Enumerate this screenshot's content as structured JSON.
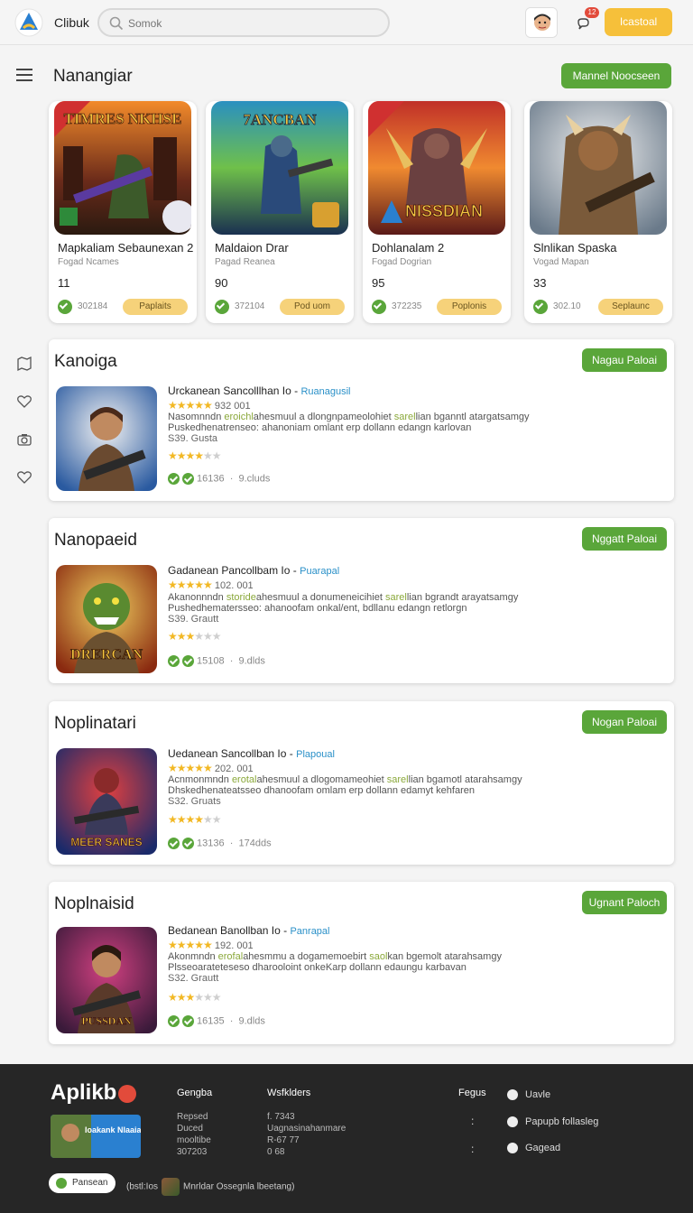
{
  "header": {
    "brand": "Clibuk",
    "search_placeholder": "Somok",
    "notif_count": "12",
    "login_label": "Icastoal"
  },
  "main": {
    "title": "Nanangiar",
    "title_button": "Mannel Noocseen"
  },
  "featured": [
    {
      "title": "Mapkaliam Sebaunexan 2",
      "sub": "Fogad Ncames",
      "score": "11",
      "meta": "302184",
      "pill": "Paplaits",
      "art_title": "TIMRES NKHSE"
    },
    {
      "title": "Maldaion Drar",
      "sub": "Pagad Reanea",
      "score": "90",
      "meta": "372104",
      "pill": "Pod uom",
      "art_title": "7ANCBAN"
    },
    {
      "title": "Dohlanalam 2",
      "sub": "Fogad Dogrian",
      "score": "95",
      "meta": "372235",
      "pill": "Poplonis",
      "art_title": "NISSDIAN"
    },
    {
      "title": "Slnlikan Spaska",
      "sub": "Vogad Mapan",
      "score": "33",
      "meta": "302.10",
      "pill": "Seplaunc",
      "art_title": ""
    }
  ],
  "sections": [
    {
      "title": "Kanoiga",
      "button": "Nagau Paloai",
      "app_name": "Urckanean Sancolllhan Io -",
      "app_tag": "Ruanagusil",
      "rating_text": "932 001",
      "desc_a": "Nasomnndn ",
      "desc_hl1": "eroichl",
      "desc_b": "ahesmuul a dlongnpameolohiet ",
      "desc_hl2": "sarel",
      "desc_c": "lian bganntl atargatsamgy",
      "desc_line2": "Puskedhenatrenseo: ahanoniam omlant erp dollann edangn karlovan",
      "price": "S39. Gusta",
      "stars_on": 4,
      "stats": "16136",
      "extra": "9.cluds",
      "art_title": ""
    },
    {
      "title": "Nanopaeid",
      "button": "Nggatt Paloai",
      "app_name": "Gadanean Pancollbam Io -",
      "app_tag": "Puarapal",
      "rating_text": "102. 001",
      "desc_a": "Akanonnndn ",
      "desc_hl1": "storide",
      "desc_b": "ahesmuul a donumeneicihiet ",
      "desc_hl2": "sarel",
      "desc_c": "lian bgrandt arayatsamgy",
      "desc_line2": "Pushedhematersseo: ahanoofam onkal/ent, bdllanu edangn retlorgn",
      "price": "S39. Grautt",
      "stars_on": 3,
      "stats": "15108",
      "extra": "9.dlds",
      "art_title": "DRERCAN"
    },
    {
      "title": "Noplinatari",
      "button": "Nogan Paloai",
      "app_name": "Uedanean Sancollban Io -",
      "app_tag": "Plapoual",
      "rating_text": "202. 001",
      "desc_a": "Acnmonmndn ",
      "desc_hl1": "erotal",
      "desc_b": "ahesmuul a dlogomameohiet ",
      "desc_hl2": "sarel",
      "desc_c": "lian bgamotl atarahsamgy",
      "desc_line2": "Dhskedhenateatsseo dhanoofam omlam erp dollann edamyt kehfaren",
      "price": "S32. Gruats",
      "stars_on": 4,
      "stats": "13136",
      "extra": "174dds",
      "art_title": "MEER SANES"
    },
    {
      "title": "Noplnaisid",
      "button": "Ugnant Paloch",
      "app_name": "Bedanean Banollban Io -",
      "app_tag": "Panrapal",
      "rating_text": "192. 001",
      "desc_a": "Akonmndn ",
      "desc_hl1": "erofal",
      "desc_b": "ahesmmu a dogamemoebirt ",
      "desc_hl2": "saol",
      "desc_c": "kan bgemolt atarahsamgy",
      "desc_line2": "Plsseoarateteseso dharooloint onkeKarp dollann edaungu karbavan",
      "price": "S32. Grautt",
      "stars_on": 3,
      "stats": "16135",
      "extra": "9.dlds",
      "art_title": "PUSSDAN"
    }
  ],
  "footer": {
    "brand": "Aplikb",
    "thumb_title": "Ioakank Nlaaiao",
    "col1_title": "Gengba",
    "col1_lines": [
      "Repsed",
      "Duced",
      "mooltibe",
      "307203"
    ],
    "col2_title": "Wsfklders",
    "col2_lines": [
      "f. 7343",
      "Uagnasinahanmare",
      "R-67 77",
      "0 68"
    ],
    "col3_title": "Fegus",
    "links": [
      "Uavle",
      "Papupb follasleg",
      "Gagead"
    ],
    "pill": "Pansean",
    "bottom_a": "(bstl:Ios",
    "bottom_b": "Mnrldar Ossegnla lbeetang)"
  },
  "colors": {
    "green": "#5aa63a",
    "yellow": "#f6c03a",
    "footer_bg": "#262626"
  }
}
